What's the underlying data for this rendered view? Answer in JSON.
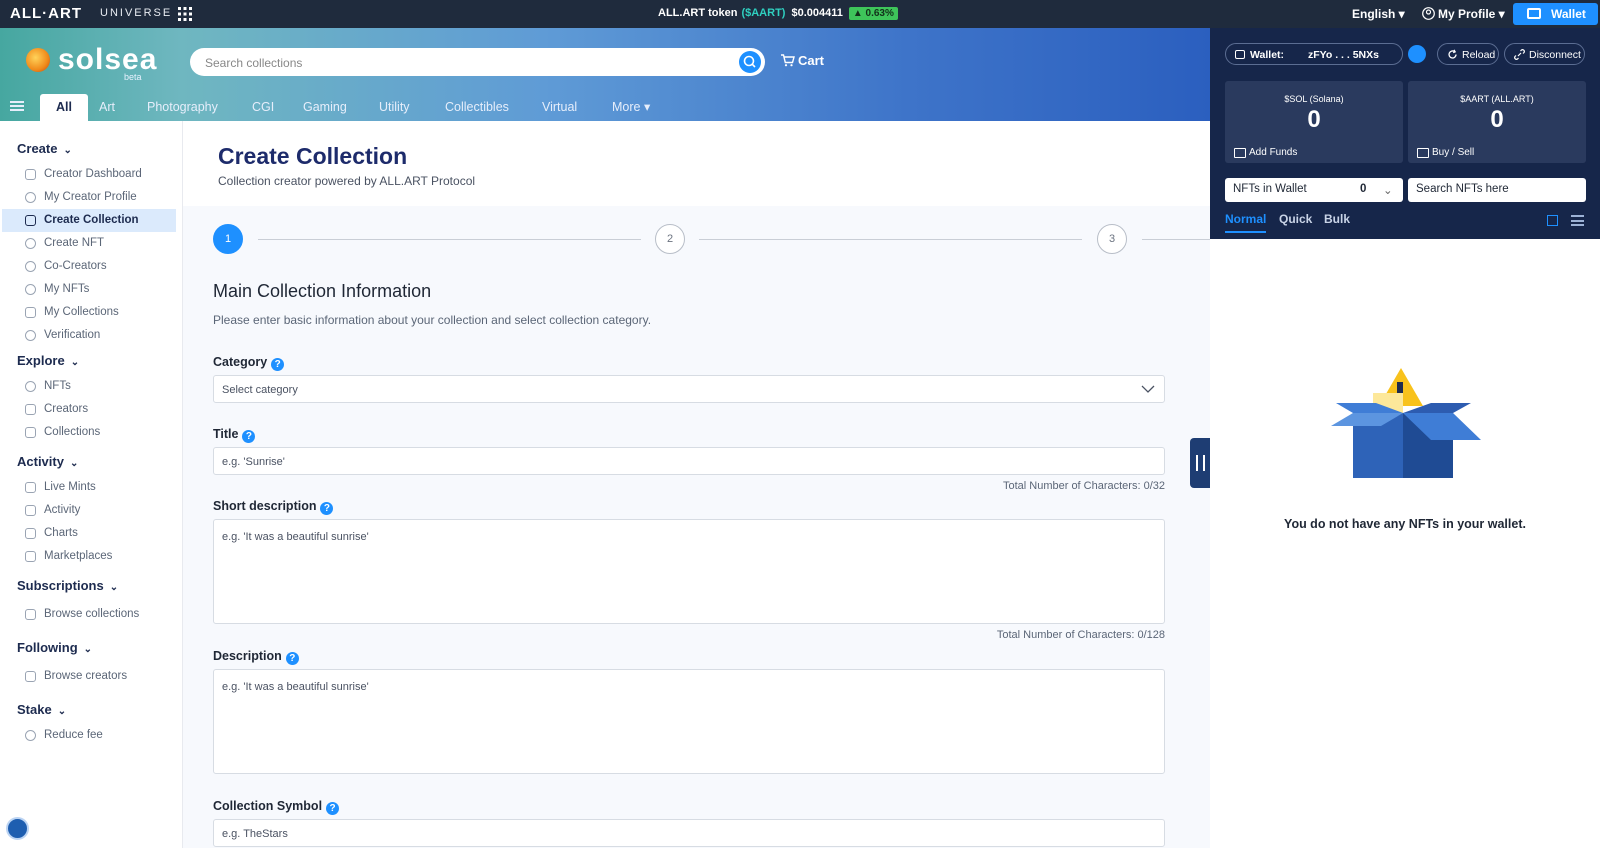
{
  "topbar": {
    "logo": "ALL·ART",
    "universe": "UNIVERSE",
    "token_label": "ALL.ART token",
    "token_symbol": "($AART)",
    "token_price": "$0.004411",
    "token_change": "▲ 0.63%",
    "language": "English ▾",
    "profile": "My Profile ▾",
    "wallet": "Wallet"
  },
  "header": {
    "brand": "solsea",
    "beta": "beta",
    "search_placeholder": "Search collections",
    "cart": "Cart",
    "tabs": [
      "All",
      "Art",
      "Photography",
      "CGI",
      "Gaming",
      "Utility",
      "Collectibles",
      "Virtual",
      "More ▾"
    ]
  },
  "sidebar": {
    "create": {
      "title": "Create",
      "items": [
        "Creator Dashboard",
        "My Creator Profile",
        "Create Collection",
        "Create NFT",
        "Co-Creators",
        "My NFTs",
        "My Collections",
        "Verification"
      ]
    },
    "explore": {
      "title": "Explore",
      "items": [
        "NFTs",
        "Creators",
        "Collections"
      ]
    },
    "activity": {
      "title": "Activity",
      "items": [
        "Live Mints",
        "Activity",
        "Charts",
        "Marketplaces"
      ]
    },
    "subscriptions": {
      "title": "Subscriptions",
      "items": [
        "Browse collections"
      ]
    },
    "following": {
      "title": "Following",
      "items": [
        "Browse creators"
      ]
    },
    "stake": {
      "title": "Stake",
      "items": [
        "Reduce fee"
      ]
    }
  },
  "main": {
    "title": "Create Collection",
    "subtitle": "Collection creator powered by ALL.ART Protocol",
    "steps": [
      "1",
      "2",
      "3"
    ],
    "section_title": "Main Collection Information",
    "section_sub": "Please enter basic information about your collection and select collection category.",
    "category_label": "Category",
    "category_placeholder": "Select category",
    "title_label": "Title",
    "title_placeholder": "e.g. 'Sunrise'",
    "title_count": "Total Number of Characters: 0/32",
    "short_label": "Short description",
    "short_placeholder": "e.g. 'It was a beautiful sunrise'",
    "short_count": "Total Number of Characters: 0/128",
    "desc_label": "Description",
    "desc_placeholder": "e.g. 'It was a beautiful sunrise'",
    "symbol_label": "Collection Symbol",
    "symbol_placeholder": "e.g. TheStars",
    "help": "?"
  },
  "wallet_panel": {
    "wallet_label": "Wallet:",
    "address": "zFYo . . . 5NXs",
    "reload": "Reload",
    "disconnect": "Disconnect",
    "sol_label": "$SOL (Solana)",
    "sol_value": "0",
    "add_funds": "Add Funds",
    "aart_label": "$AART (ALL.ART)",
    "aart_value": "0",
    "buy_sell": "Buy / Sell",
    "nfts_label": "NFTs in Wallet",
    "nfts_count": "0",
    "search_nfts": "Search NFTs here",
    "view_tabs": [
      "Normal",
      "Quick",
      "Bulk"
    ],
    "empty_message": "You do not have any NFTs in your wallet."
  },
  "colors": {
    "accent": "#1e90ff",
    "topbar": "#1f2b3d",
    "panel": "#16264a",
    "title": "#1d2b6b"
  }
}
